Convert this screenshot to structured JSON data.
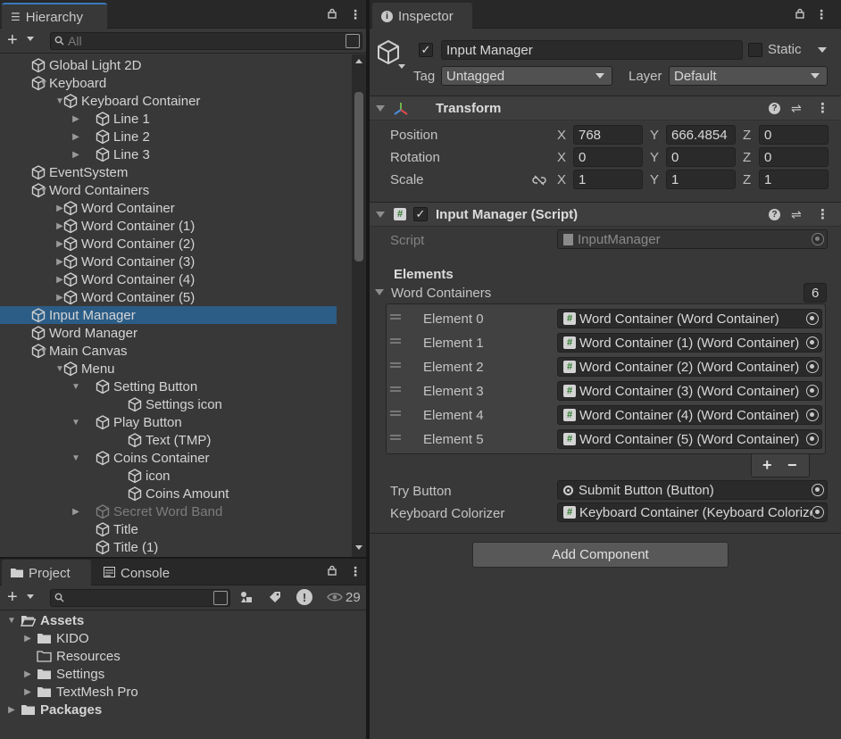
{
  "hierarchy": {
    "tab_label": "Hierarchy",
    "search_placeholder": "All",
    "items": [
      {
        "label": "Global Light 2D",
        "depth": 1,
        "fold": "",
        "dim": false,
        "selected": false
      },
      {
        "label": "Keyboard",
        "depth": 1,
        "fold": "open",
        "dim": false,
        "selected": false
      },
      {
        "label": "Keyboard Container",
        "depth": 2,
        "fold": "open",
        "dim": false,
        "selected": false
      },
      {
        "label": "Line 1",
        "depth": 3,
        "fold": "closed",
        "dim": false,
        "selected": false
      },
      {
        "label": "Line 2",
        "depth": 3,
        "fold": "closed",
        "dim": false,
        "selected": false
      },
      {
        "label": "Line 3",
        "depth": 3,
        "fold": "closed",
        "dim": false,
        "selected": false
      },
      {
        "label": "EventSystem",
        "depth": 1,
        "fold": "",
        "dim": false,
        "selected": false
      },
      {
        "label": "Word Containers",
        "depth": 1,
        "fold": "open",
        "dim": false,
        "selected": false
      },
      {
        "label": "Word Container",
        "depth": 2,
        "fold": "closed",
        "dim": false,
        "selected": false
      },
      {
        "label": "Word Container (1)",
        "depth": 2,
        "fold": "closed",
        "dim": false,
        "selected": false
      },
      {
        "label": "Word Container (2)",
        "depth": 2,
        "fold": "closed",
        "dim": false,
        "selected": false
      },
      {
        "label": "Word Container (3)",
        "depth": 2,
        "fold": "closed",
        "dim": false,
        "selected": false
      },
      {
        "label": "Word Container (4)",
        "depth": 2,
        "fold": "closed",
        "dim": false,
        "selected": false
      },
      {
        "label": "Word Container (5)",
        "depth": 2,
        "fold": "closed",
        "dim": false,
        "selected": false
      },
      {
        "label": "Input Manager",
        "depth": 1,
        "fold": "",
        "dim": false,
        "selected": true
      },
      {
        "label": "Word Manager",
        "depth": 1,
        "fold": "",
        "dim": false,
        "selected": false
      },
      {
        "label": "Main Canvas",
        "depth": 1,
        "fold": "open",
        "dim": false,
        "selected": false
      },
      {
        "label": "Menu",
        "depth": 2,
        "fold": "open",
        "dim": false,
        "selected": false
      },
      {
        "label": "Setting Button",
        "depth": 3,
        "fold": "open",
        "dim": false,
        "selected": false
      },
      {
        "label": "Settings icon",
        "depth": 4,
        "fold": "",
        "dim": false,
        "selected": false
      },
      {
        "label": "Play Button",
        "depth": 3,
        "fold": "open",
        "dim": false,
        "selected": false
      },
      {
        "label": "Text (TMP)",
        "depth": 4,
        "fold": "",
        "dim": false,
        "selected": false
      },
      {
        "label": "Coins Container",
        "depth": 3,
        "fold": "open",
        "dim": false,
        "selected": false
      },
      {
        "label": "icon",
        "depth": 4,
        "fold": "",
        "dim": false,
        "selected": false
      },
      {
        "label": "Coins Amount",
        "depth": 4,
        "fold": "",
        "dim": false,
        "selected": false
      },
      {
        "label": "Secret Word Band",
        "depth": 3,
        "fold": "closed",
        "dim": true,
        "selected": false
      },
      {
        "label": "Title",
        "depth": 3,
        "fold": "",
        "dim": false,
        "selected": false
      },
      {
        "label": "Title (1)",
        "depth": 3,
        "fold": "",
        "dim": false,
        "selected": false
      }
    ]
  },
  "project": {
    "tab_label": "Project",
    "console_tab_label": "Console",
    "hidden_count": "29",
    "items": [
      {
        "label": "Assets",
        "depth": 0,
        "fold": "open",
        "bold": true,
        "folder": "open"
      },
      {
        "label": "KIDO",
        "depth": 1,
        "fold": "closed",
        "bold": false,
        "folder": "filled"
      },
      {
        "label": "Resources",
        "depth": 1,
        "fold": "",
        "bold": false,
        "folder": "empty"
      },
      {
        "label": "Settings",
        "depth": 1,
        "fold": "closed",
        "bold": false,
        "folder": "filled"
      },
      {
        "label": "TextMesh Pro",
        "depth": 1,
        "fold": "closed",
        "bold": false,
        "folder": "filled"
      },
      {
        "label": "Packages",
        "depth": 0,
        "fold": "closed",
        "bold": true,
        "folder": "filled"
      }
    ]
  },
  "inspector": {
    "tab_label": "Inspector",
    "object_name": "Input Manager",
    "static_label": "Static",
    "tag_label": "Tag",
    "tag_value": "Untagged",
    "layer_label": "Layer",
    "layer_value": "Default",
    "transform": {
      "title": "Transform",
      "position_label": "Position",
      "rotation_label": "Rotation",
      "scale_label": "Scale",
      "x": "X",
      "y": "Y",
      "z": "Z",
      "position": [
        "768",
        "666.4854",
        "0"
      ],
      "rotation": [
        "0",
        "0",
        "0"
      ],
      "scale": [
        "1",
        "1",
        "1"
      ]
    },
    "script_component": {
      "title": "Input Manager (Script)",
      "script_label": "Script",
      "script_value": "InputManager",
      "elements_header": "Elements",
      "list_label": "Word Containers",
      "list_count": "6",
      "elements": [
        {
          "label": "Element 0",
          "value": "Word Container (Word Container)"
        },
        {
          "label": "Element 1",
          "value": "Word Container (1) (Word Container)"
        },
        {
          "label": "Element 2",
          "value": "Word Container (2) (Word Container)"
        },
        {
          "label": "Element 3",
          "value": "Word Container (3) (Word Container)"
        },
        {
          "label": "Element 4",
          "value": "Word Container (4) (Word Container)"
        },
        {
          "label": "Element 5",
          "value": "Word Container (5) (Word Container)"
        }
      ],
      "add_label": "+",
      "remove_label": "−",
      "try_button_label": "Try Button",
      "try_button_value": "Submit Button (Button)",
      "keyboard_colorizer_label": "Keyboard Colorizer",
      "keyboard_colorizer_value": "Keyboard Container (Keyboard Colorizer)"
    },
    "add_component_label": "Add Component"
  },
  "colors": {
    "selection": "#2c5d87",
    "panel": "#383838",
    "field": "#2a2a2a"
  }
}
